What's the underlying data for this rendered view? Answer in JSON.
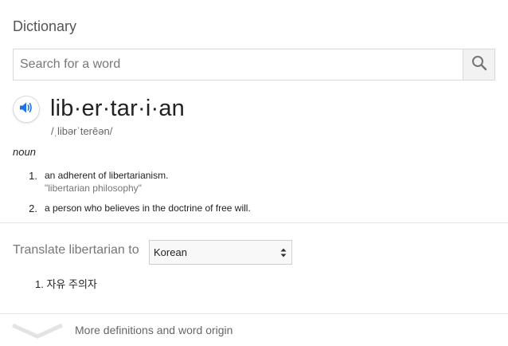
{
  "dictionary": {
    "title": "Dictionary",
    "search": {
      "placeholder": "Search for a word",
      "value": ""
    },
    "entry": {
      "headword": "lib·er·tar·i·an",
      "pronunciation": "/ˌlibərˈterēən/",
      "part_of_speech": "noun",
      "definitions": [
        {
          "number": "1.",
          "text": "an adherent of libertarianism.",
          "example": "\"libertarian philosophy\""
        },
        {
          "number": "2.",
          "text": "a person who believes in the doctrine of free will.",
          "example": ""
        }
      ]
    },
    "translate": {
      "label": "Translate libertarian to",
      "selected_language": "Korean",
      "results": [
        {
          "text": "1. 자유 주의자"
        }
      ]
    },
    "more": {
      "label": "More definitions and word origin"
    }
  },
  "icons": {
    "search": "search-icon",
    "speaker": "speaker-icon",
    "chevron": "chevron-down-icon",
    "select_arrows": "select-arrows-icon"
  },
  "colors": {
    "accent_blue": "#1a73e8",
    "icon_gray": "#757575",
    "text_muted": "#777777"
  }
}
